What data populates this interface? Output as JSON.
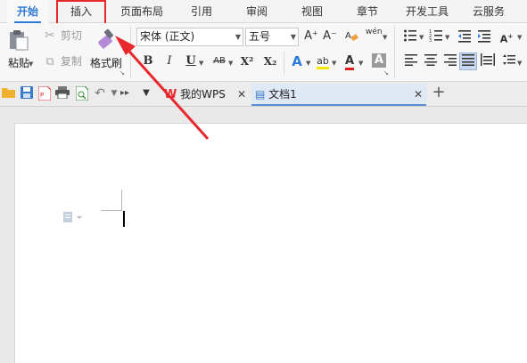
{
  "menu": {
    "tabs": [
      {
        "label": "开始",
        "active": true
      },
      {
        "label": "插入",
        "highlighted": true
      },
      {
        "label": "页面布局"
      },
      {
        "label": "引用"
      },
      {
        "label": "审阅"
      },
      {
        "label": "视图"
      },
      {
        "label": "章节"
      },
      {
        "label": "开发工具"
      },
      {
        "label": "云服务"
      }
    ]
  },
  "ribbon": {
    "clipboard": {
      "paste_label": "粘贴",
      "cut_label": "剪切",
      "copy_label": "复制",
      "format_painter_label": "格式刷"
    },
    "font": {
      "name": "宋体 (正文)",
      "size": "五号",
      "grow_glyph": "A⁺",
      "shrink_glyph": "A⁻",
      "bold": "B",
      "italic": "I",
      "underline": "U",
      "superscript": "X²",
      "subscript": "X₂",
      "strike_glyph": "AB",
      "phonetic_glyph": "wén",
      "font_color_glyph": "A",
      "highlight_glyph": "ab",
      "shading_glyph": "A"
    },
    "colors": {
      "font_color": "#e02020",
      "highlight_color": "#f5e600",
      "accent": "#2d7ad8",
      "annotation": "#e8282c"
    }
  },
  "quickbar": {
    "tabs": [
      {
        "label": "我的WPS",
        "icon": "wps-logo-icon"
      },
      {
        "label": "文档1",
        "icon": "document-icon",
        "active": true
      }
    ],
    "new_tab_glyph": "+"
  }
}
